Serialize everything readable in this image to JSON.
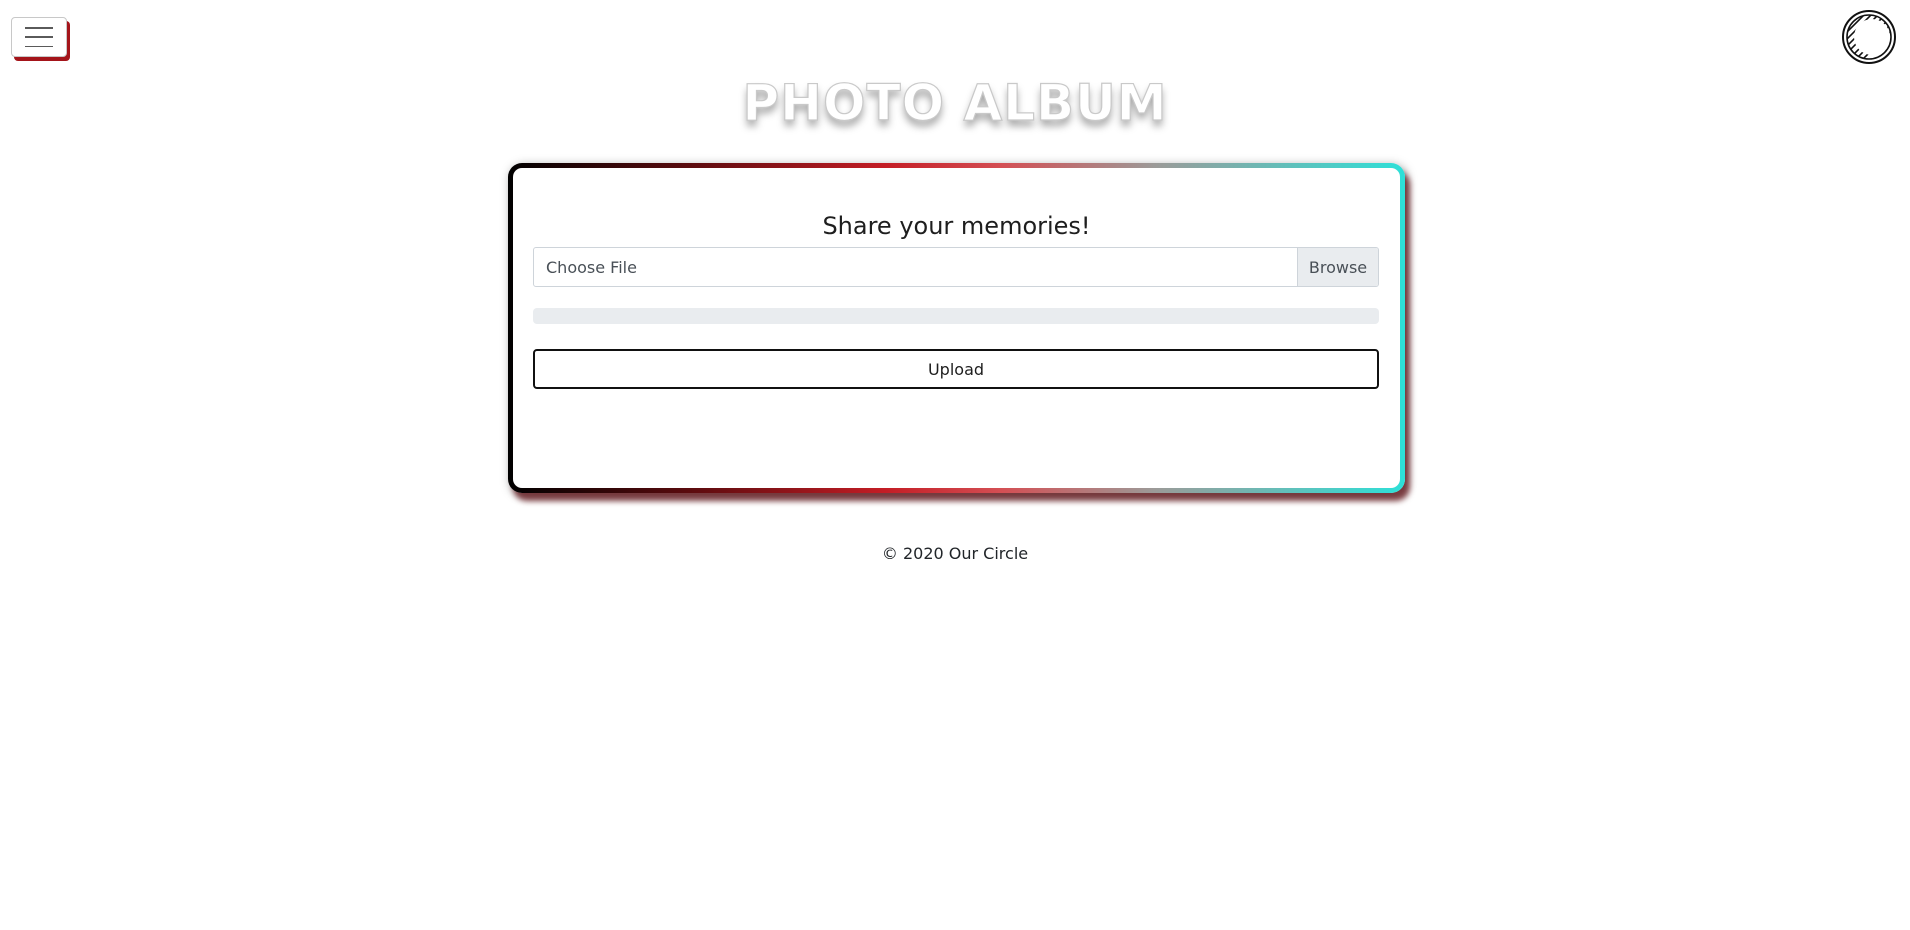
{
  "header": {
    "menu_icon": "hamburger-menu-icon",
    "logo_icon": "circle-logo-icon",
    "title": "PHOTO ALBUM"
  },
  "upload_card": {
    "heading": "Share your memories!",
    "file_input": {
      "placeholder": "Choose File",
      "browse_label": "Browse"
    },
    "progress": 0,
    "upload_label": "Upload"
  },
  "footer": {
    "text": "© 2020 Our Circle"
  },
  "colors": {
    "frame_gradient": [
      "#000000",
      "#c41d25",
      "#9c9a98",
      "#2de0d8"
    ],
    "menu_shadow": "#a4141a",
    "progress_track": "#e9ecef"
  }
}
